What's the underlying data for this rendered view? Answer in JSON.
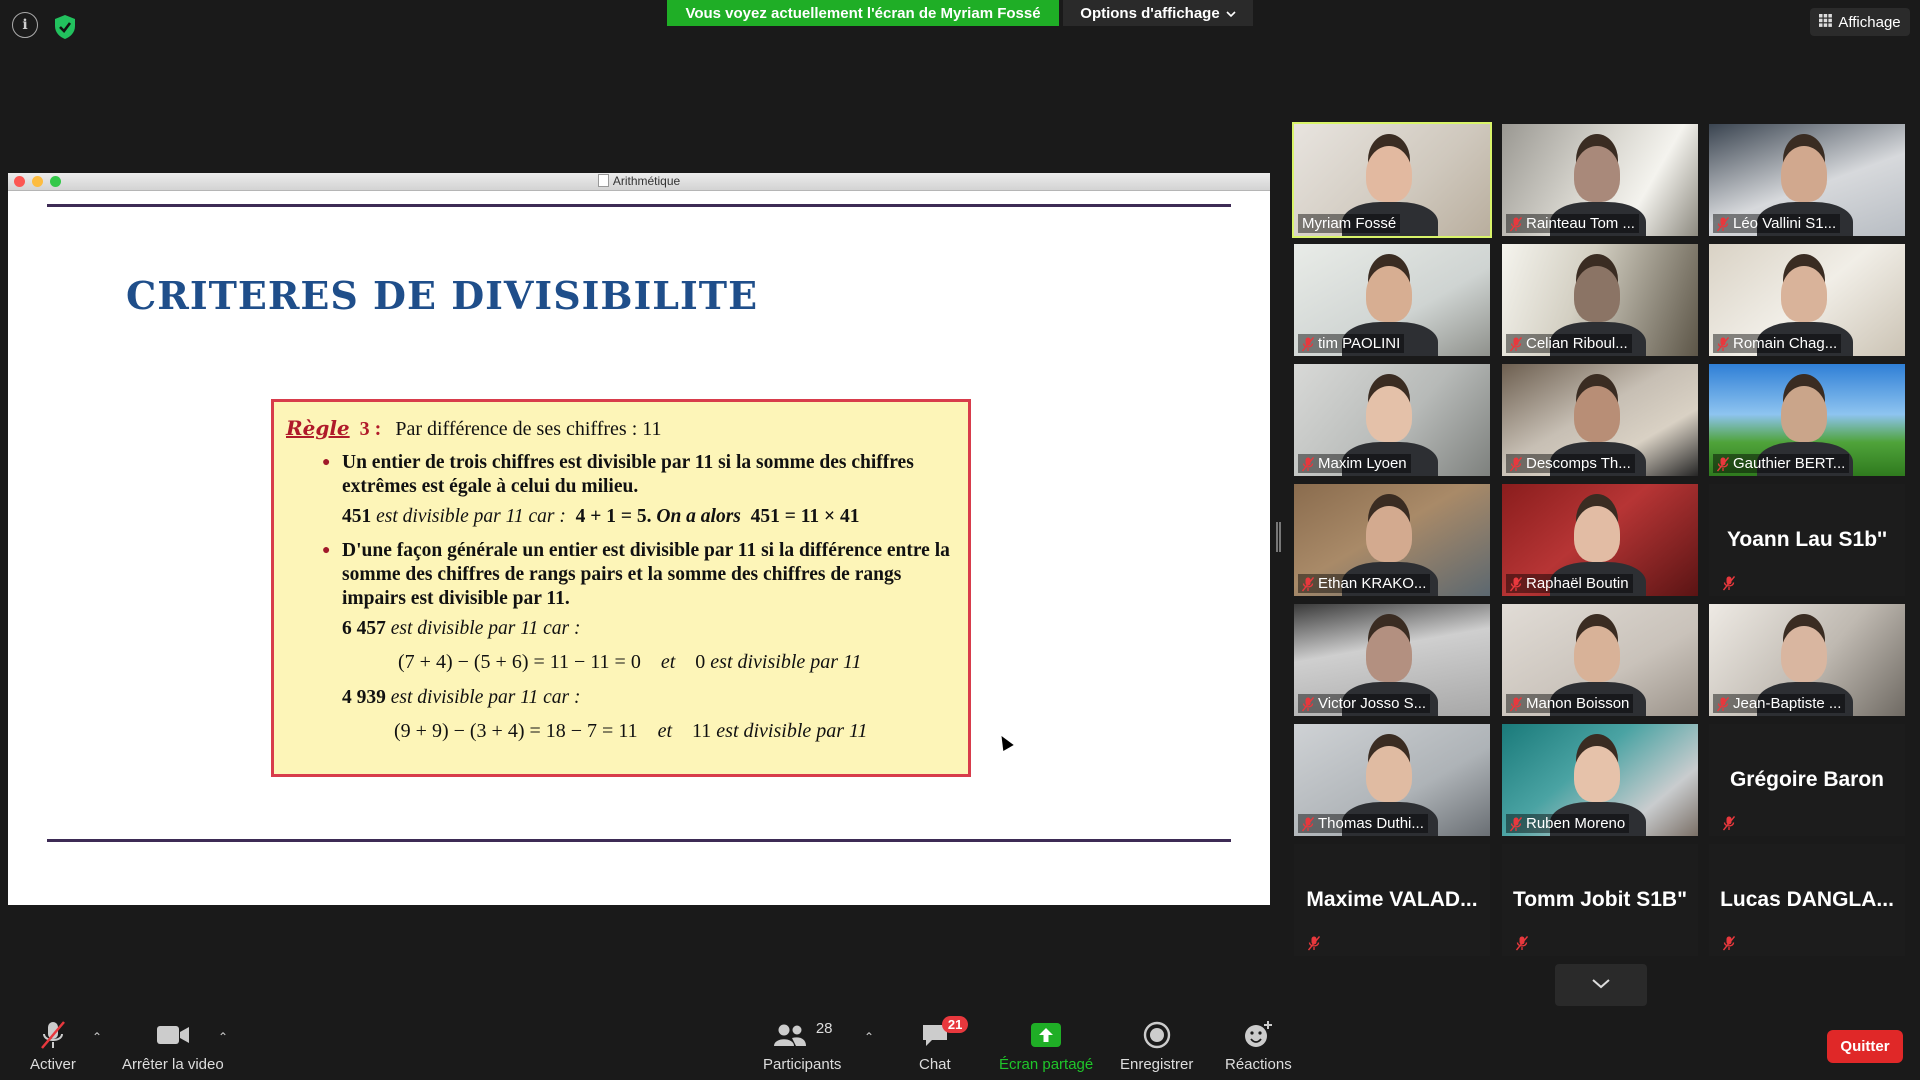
{
  "top": {
    "banner": "Vous voyez actuellement l'écran de Myriam Fossé",
    "view_options": "Options d'affichage",
    "display_label": "Affichage"
  },
  "share": {
    "window_title": "Arithmétique",
    "slide_title": "CRITERES DE DIVISIBILITE",
    "rule_word": "Règle",
    "rule_number": "3 :",
    "rule_heading": "Par différence de ses chiffres : 11",
    "bullet1": "Un entier de trois chiffres est divisible par 11 si la somme des chiffres extrêmes est égale à celui du milieu.",
    "example1_start": "451",
    "example1_mid": "est divisible par 11 car :",
    "example1_eq": "4 + 1 = 5.",
    "example1_then": "On a alors",
    "example1_result": "451 = 11 × 41",
    "bullet2": "D'une façon générale un entier est divisible par 11 si la différence entre la somme des chiffres de rangs pairs et la somme des chiffres de rangs impairs est divisible par 11.",
    "example2_num": "6 457",
    "example2_text": "est divisible par 11 car :",
    "example2_eq": "(7 + 4) − (5 + 6) = 11 − 11 = 0",
    "example2_and": "et",
    "example2_concl_num": "0",
    "example2_concl": "est divisible par 11",
    "example3_num": "4 939",
    "example3_text": "est divisible par 11 car :",
    "example3_eq": "(9 + 9) − (3 + 4) = 18 − 7 = 11",
    "example3_and": "et",
    "example3_concl_num": "11",
    "example3_concl": "est divisible par 11"
  },
  "participants": [
    {
      "name": "Myriam Fossé",
      "video": true,
      "muted": false,
      "active": true
    },
    {
      "name": "Rainteau Tom ...",
      "video": true,
      "muted": true
    },
    {
      "name": "Léo Vallini S1...",
      "video": true,
      "muted": true
    },
    {
      "name": "tim PAOLINI",
      "video": true,
      "muted": true
    },
    {
      "name": "Celian Riboul...",
      "video": true,
      "muted": true
    },
    {
      "name": "Romain Chag...",
      "video": true,
      "muted": true
    },
    {
      "name": "Maxim Lyoen",
      "video": true,
      "muted": true
    },
    {
      "name": "Descomps Th...",
      "video": true,
      "muted": true
    },
    {
      "name": "Gauthier BERT...",
      "video": true,
      "muted": true
    },
    {
      "name": "Ethan KRAKO...",
      "video": true,
      "muted": true
    },
    {
      "name": "Raphaël Boutin",
      "video": true,
      "muted": true
    },
    {
      "name": "Yoann Lau S1b''",
      "video": false,
      "muted": true
    },
    {
      "name": "Victor Josso S...",
      "video": true,
      "muted": true
    },
    {
      "name": "Manon Boisson",
      "video": true,
      "muted": true
    },
    {
      "name": "Jean-Baptiste ...",
      "video": true,
      "muted": true
    },
    {
      "name": "Thomas Duthi...",
      "video": true,
      "muted": true
    },
    {
      "name": "Ruben Moreno",
      "video": true,
      "muted": true
    },
    {
      "name": "Grégoire Baron",
      "video": false,
      "muted": true
    },
    {
      "name": "Maxime  VALAD...",
      "video": false,
      "muted": true
    },
    {
      "name": "Tomm Jobit S1B\"",
      "video": false,
      "muted": true
    },
    {
      "name": "Lucas  DANGLA...",
      "video": false,
      "muted": true
    }
  ],
  "toolbar": {
    "unmute_label": "Activer",
    "stop_video_label": "Arrêter la video",
    "participants_label": "Participants",
    "participants_count": "28",
    "chat_label": "Chat",
    "chat_badge": "21",
    "share_label": "Écran partagé",
    "record_label": "Enregistrer",
    "reactions_label": "Réactions",
    "quit_label": "Quitter"
  },
  "colors": {
    "banner_green": "#1fae26",
    "active_speaker": "#d9f46a",
    "quit_red": "#e02828",
    "mute_red": "#e8383d"
  }
}
